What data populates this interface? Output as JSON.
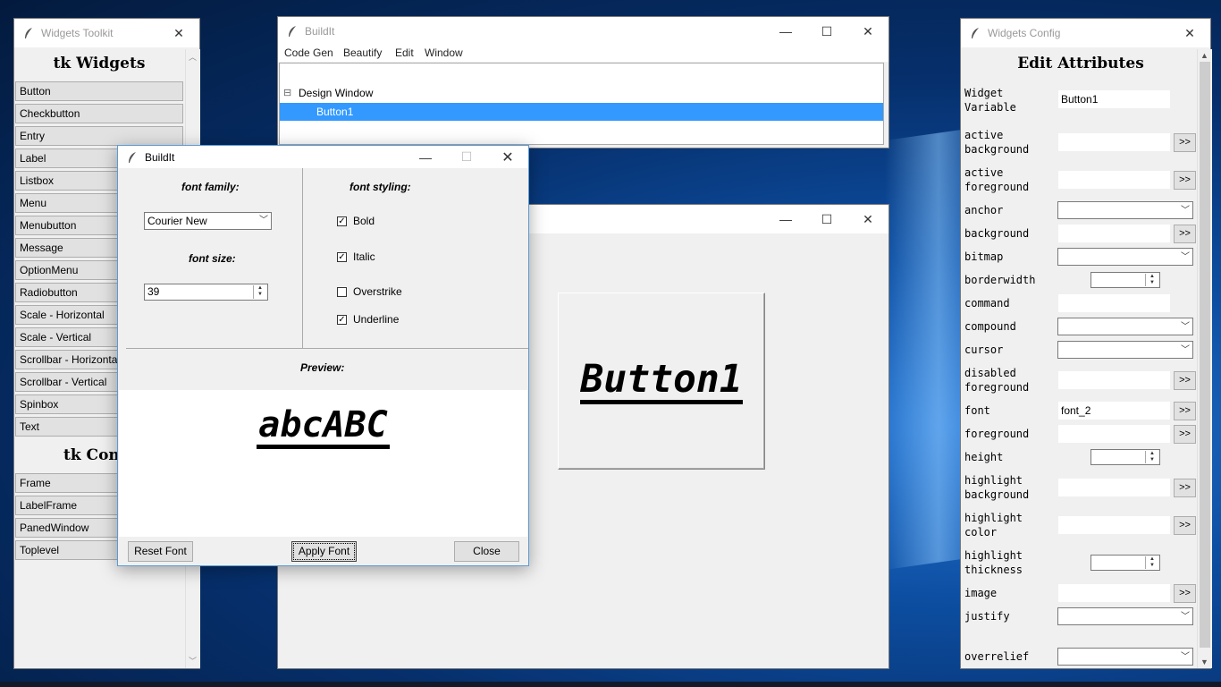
{
  "toolkit": {
    "title": "Widgets Toolkit",
    "widgets_heading": "tk Widgets",
    "widgets": [
      "Button",
      "Checkbutton",
      "Entry",
      "Label",
      "Listbox",
      "Menu",
      "Menubutton",
      "Message",
      "OptionMenu",
      "Radiobutton",
      "Scale - Horizontal",
      "Scale - Vertical",
      "Scrollbar - Horizontal",
      "Scrollbar - Vertical",
      "Spinbox",
      "Text"
    ],
    "containers_heading": "tk Containers",
    "containers": [
      "Frame",
      "LabelFrame",
      "PanedWindow",
      "Toplevel"
    ]
  },
  "main": {
    "title": "BuildIt",
    "menu": [
      "Code Gen",
      "Beautify",
      "Edit",
      "Window"
    ],
    "tree": {
      "root": "Design Window",
      "child": "Button1"
    },
    "collapse_glyph": "⊟"
  },
  "design": {
    "button_text": "Button1"
  },
  "font_dialog": {
    "title": "BuildIt",
    "font_family_label": "font family:",
    "font_family_value": "Courier New",
    "font_size_label": "font size:",
    "font_size_value": "39",
    "font_styling_label": "font styling:",
    "styles": [
      {
        "label": "Bold",
        "checked": true
      },
      {
        "label": "Italic",
        "checked": true
      },
      {
        "label": "Overstrike",
        "checked": false
      },
      {
        "label": "Underline",
        "checked": true
      }
    ],
    "preview_label": "Preview:",
    "preview_text": "abcABC",
    "buttons": {
      "reset": "Reset Font",
      "apply": "Apply Font",
      "close": "Close"
    }
  },
  "config": {
    "title": "Widgets Config",
    "heading": "Edit Attributes",
    "widget_variable_label": "Widget\nVariable",
    "widget_variable_value": "Button1",
    "attrs": [
      {
        "label": "active\nbackground",
        "kind": "entry-btn",
        "value": ""
      },
      {
        "label": "active\nforeground",
        "kind": "entry-btn",
        "value": ""
      },
      {
        "label": "anchor",
        "kind": "combo",
        "value": ""
      },
      {
        "label": "background",
        "kind": "entry-btn",
        "value": ""
      },
      {
        "label": "bitmap",
        "kind": "combo",
        "value": ""
      },
      {
        "label": "borderwidth",
        "kind": "spin",
        "value": ""
      },
      {
        "label": "command",
        "kind": "entry",
        "value": ""
      },
      {
        "label": "compound",
        "kind": "combo",
        "value": ""
      },
      {
        "label": "cursor",
        "kind": "combo",
        "value": ""
      },
      {
        "label": "disabled\nforeground",
        "kind": "entry-btn",
        "value": ""
      },
      {
        "label": "font",
        "kind": "entry-btn",
        "value": "font_2"
      },
      {
        "label": "foreground",
        "kind": "entry-btn",
        "value": ""
      },
      {
        "label": "height",
        "kind": "spin",
        "value": ""
      },
      {
        "label": "highlight\nbackground",
        "kind": "entry-btn",
        "value": ""
      },
      {
        "label": "highlight\ncolor",
        "kind": "entry-btn",
        "value": ""
      },
      {
        "label": "highlight\nthickness",
        "kind": "spin",
        "value": ""
      },
      {
        "label": "image",
        "kind": "entry-btn",
        "value": ""
      },
      {
        "label": "justify",
        "kind": "combo",
        "value": ""
      },
      {
        "label": "overrelief",
        "kind": "combo",
        "value": ""
      }
    ],
    "more_button": ">>"
  },
  "colors": {
    "selection": "#3399ff",
    "dialog_border": "#5a9bd5"
  }
}
